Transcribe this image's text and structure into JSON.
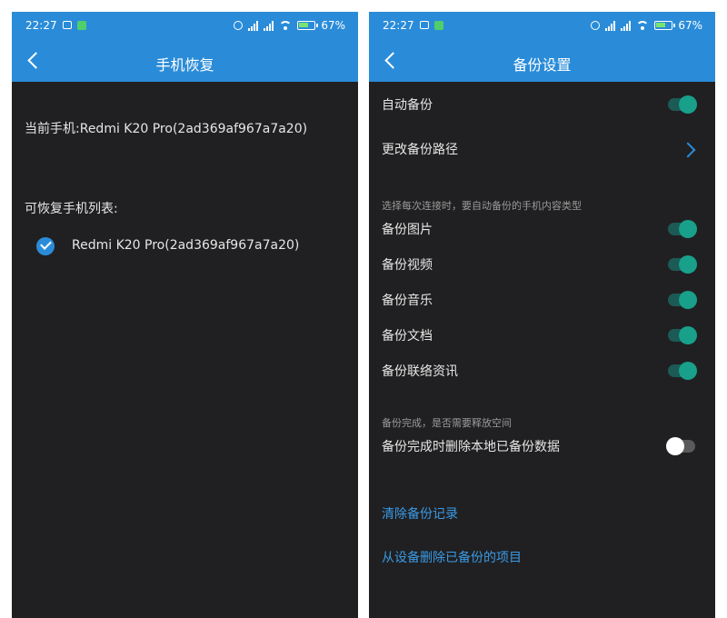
{
  "status_bar": {
    "time": "22:27",
    "battery": "67%"
  },
  "restore_screen": {
    "title": "手机恢复",
    "current_phone": "当前手机:Redmi K20 Pro(2ad369af967a7a20)",
    "list_heading": "可恢复手机列表:",
    "phones": [
      {
        "name": "Redmi K20 Pro(2ad369af967a7a20)",
        "checked": true
      }
    ]
  },
  "backup_settings": {
    "title": "备份设置",
    "auto_backup": {
      "label": "自动备份",
      "on": true
    },
    "change_path": {
      "label": "更改备份路径"
    },
    "content_section_label": "选择每次连接时，要自动备份的手机内容类型",
    "content_toggles": [
      {
        "label": "备份图片",
        "on": true
      },
      {
        "label": "备份视频",
        "on": true
      },
      {
        "label": "备份音乐",
        "on": true
      },
      {
        "label": "备份文档",
        "on": true
      },
      {
        "label": "备份联络资讯",
        "on": true
      }
    ],
    "free_space_section_label": "备份完成，是否需要释放空间",
    "delete_after_backup": {
      "label": "备份完成时删除本地已备份数据",
      "on": false
    },
    "clear_history_link": "清除备份记录",
    "delete_from_device_link": "从设备删除已备份的项目"
  },
  "colors": {
    "accent": "#2a8cd9",
    "toggle_on": "#18a08b",
    "background": "#202022",
    "link": "#3a9ae6"
  }
}
